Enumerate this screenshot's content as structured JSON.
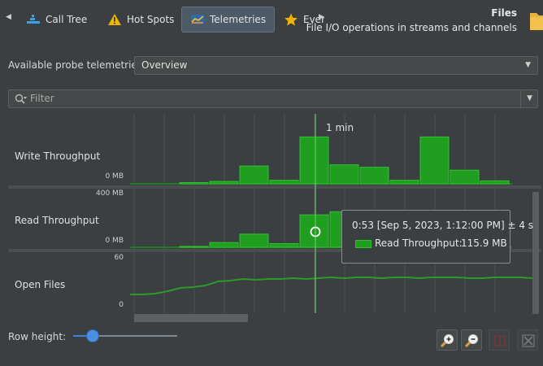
{
  "tabs": [
    {
      "label": "Call Tree",
      "icon": "call-tree-icon",
      "active": false
    },
    {
      "label": "Hot Spots",
      "icon": "warning-icon",
      "active": false
    },
    {
      "label": "Telemetries",
      "icon": "telemetries-icon",
      "active": true
    },
    {
      "label": "Ever",
      "icon": "star-icon",
      "active": false
    }
  ],
  "header": {
    "title": "Files",
    "description": "File I/O operations in streams and channels",
    "icon": "folder-icon"
  },
  "probe": {
    "label": "Available probe telemetries:",
    "selected": "Overview"
  },
  "filter": {
    "placeholder": "Filter"
  },
  "chart": {
    "time_marker": "1 min",
    "rows": [
      {
        "name": "Write Throughput",
        "min_label": "0 MB",
        "max_label": ""
      },
      {
        "name": "Read Throughput",
        "min_label": "0 MB",
        "max_label": "400 MB"
      },
      {
        "name": "Open Files",
        "min_label": "0",
        "max_label": "60"
      }
    ]
  },
  "tooltip": {
    "time": "0:53 [Sep 5, 2023, 1:12:00 PM] ± 4 s",
    "series": "Read Throughput:",
    "value": "115.9 MB"
  },
  "bottom": {
    "row_height_label": "Row height:",
    "row_height_level": 0.19
  },
  "chart_data": [
    {
      "type": "bar",
      "title": "",
      "series": [
        {
          "name": "Write Throughput",
          "values": [
            2,
            4,
            30,
            6,
            79,
            32,
            28,
            6,
            79,
            23,
            5
          ]
        }
      ],
      "xlabel": "",
      "ylabel": ""
    },
    {
      "type": "bar",
      "title": "",
      "series": [
        {
          "name": "Read Throughput",
          "values": [
            2,
            17,
            47,
            13,
            116,
            127,
            47,
            4,
            65,
            17,
            2
          ]
        }
      ],
      "ylim": [
        0,
        400
      ]
    },
    {
      "type": "line",
      "title": "",
      "series": [
        {
          "name": "Open Files",
          "values": [
            15,
            15,
            16,
            19,
            23,
            24,
            26,
            31,
            32,
            34,
            33,
            34,
            34,
            35,
            34,
            35,
            36,
            35,
            36,
            36,
            35,
            36,
            36,
            35,
            36,
            36,
            36,
            35,
            35,
            36,
            36,
            36,
            35
          ]
        }
      ],
      "ylim": [
        0,
        60
      ]
    }
  ],
  "colors": {
    "bar_fill": "#1f9e1f",
    "bar_border": "#31c231",
    "line": "#2a9a2a",
    "cursor": "#6ec46e",
    "active_tab": "#4c5a66"
  }
}
